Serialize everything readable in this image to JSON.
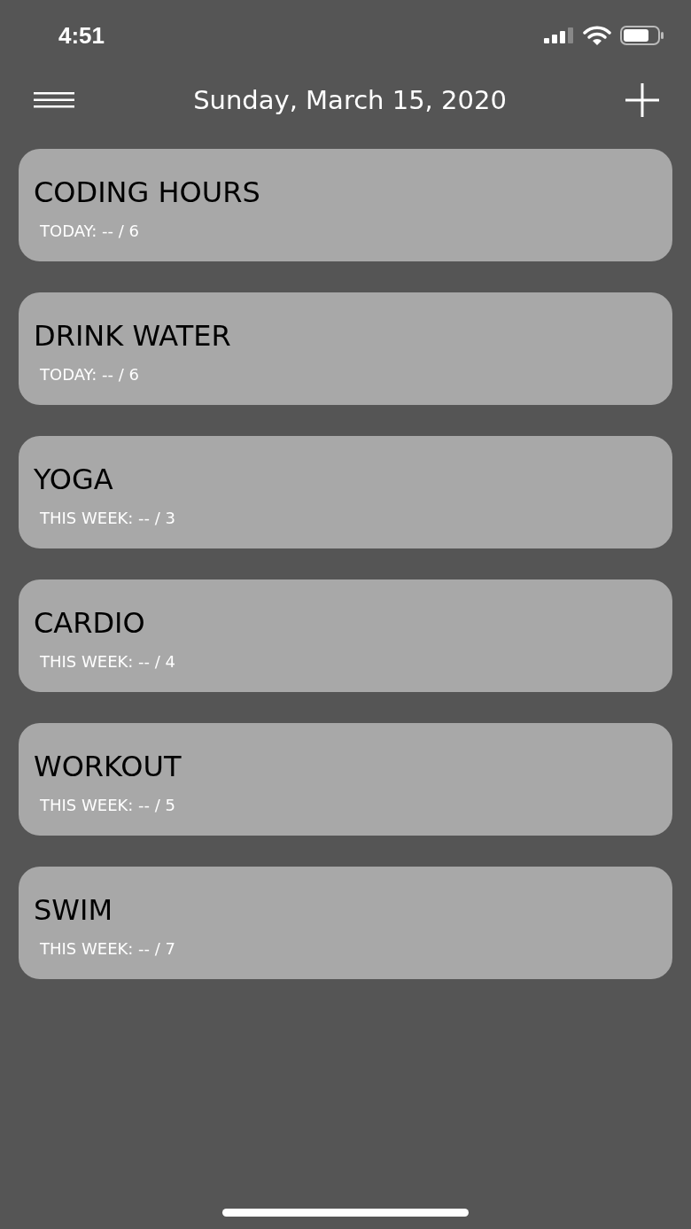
{
  "status_bar": {
    "time": "4:51"
  },
  "header": {
    "title": "Sunday, March 15, 2020"
  },
  "habits": [
    {
      "name": "CODING HOURS",
      "progress": "TODAY: -- / 6"
    },
    {
      "name": "DRINK WATER",
      "progress": "TODAY: -- / 6"
    },
    {
      "name": "YOGA",
      "progress": "THIS WEEK: -- / 3"
    },
    {
      "name": "CARDIO",
      "progress": "THIS WEEK: -- / 4"
    },
    {
      "name": "WORKOUT",
      "progress": "THIS WEEK: -- / 5"
    },
    {
      "name": "SWIM",
      "progress": "THIS WEEK: -- / 7"
    }
  ]
}
